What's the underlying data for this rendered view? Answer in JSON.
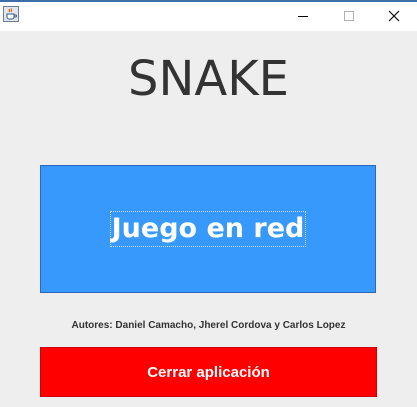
{
  "window": {
    "title": "",
    "controls": {
      "minimize_icon": "minimize-icon",
      "maximize_icon": "maximize-icon",
      "close_icon": "close-icon"
    },
    "app_icon": "java-cup-icon"
  },
  "main": {
    "title": "SNAKE",
    "network_button_label": "Juego en red",
    "authors_text": "Autores: Daniel Camacho, Jherel Cordova y Carlos Lopez",
    "close_button_label": "Cerrar aplicación"
  },
  "colors": {
    "background": "#eeeeee",
    "network_button": "#3899fc",
    "close_button": "#ff0000",
    "title_text": "#333333"
  }
}
